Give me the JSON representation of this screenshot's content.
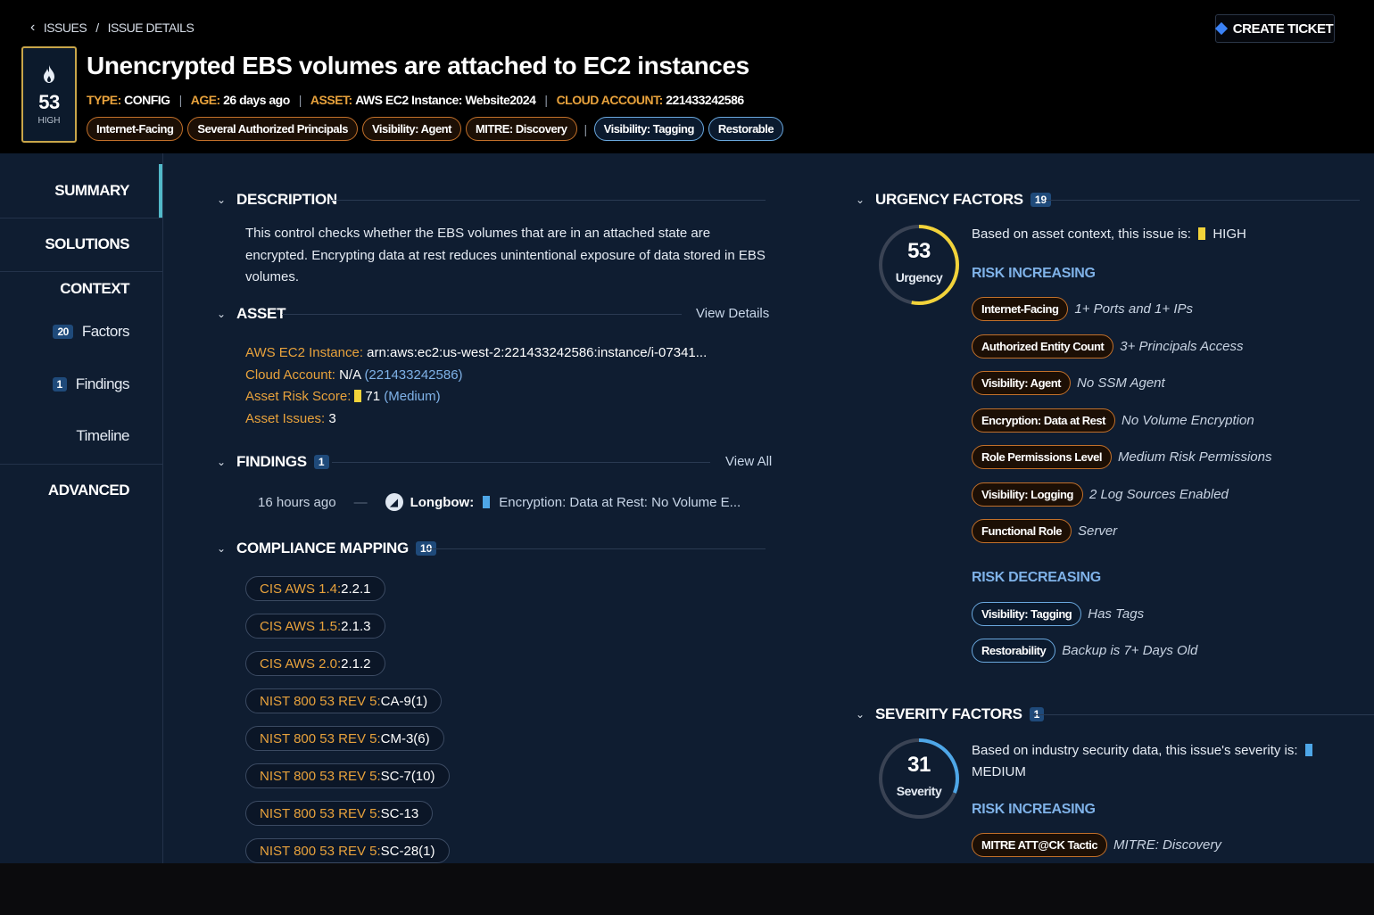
{
  "breadcrumb": {
    "issues": "ISSUES",
    "sep": "/",
    "current": "ISSUE DETAILS"
  },
  "create_ticket": "CREATE TICKET",
  "score": {
    "value": "53",
    "level": "HIGH"
  },
  "title": "Unencrypted EBS volumes are attached to EC2 instances",
  "meta": [
    {
      "key": "TYPE:",
      "value": "CONFIG"
    },
    {
      "key": "AGE:",
      "value": "26 days ago"
    },
    {
      "key": "ASSET:",
      "value": "AWS EC2 Instance: Website2024"
    },
    {
      "key": "CLOUD ACCOUNT:",
      "value": "221433242586"
    }
  ],
  "tags_orange": [
    "Internet-Facing",
    "Several Authorized Principals",
    "Visibility: Agent",
    "MITRE: Discovery"
  ],
  "tags_blue": [
    "Visibility: Tagging",
    "Restorable"
  ],
  "nav": {
    "summary": "SUMMARY",
    "solutions": "SOLUTIONS",
    "context": "CONTEXT",
    "factors_count": "20",
    "factors": "Factors",
    "findings_count": "1",
    "findings": "Findings",
    "timeline": "Timeline",
    "advanced": "ADVANCED"
  },
  "description": {
    "title": "DESCRIPTION",
    "text": "This control checks whether the EBS volumes that are in an attached state are encrypted. Encrypting data at rest reduces unintentional exposure of data stored in EBS volumes."
  },
  "asset": {
    "title": "ASSET",
    "link": "View Details",
    "instance_key": "AWS EC2 Instance:",
    "instance_val": "arn:aws:ec2:us-west-2:221433242586:instance/i-07341...",
    "account_key": "Cloud Account:",
    "account_val": "N/A",
    "account_id": "(221433242586)",
    "risk_key": "Asset Risk Score:",
    "risk_val": "71",
    "risk_level": "(Medium)",
    "issues_key": "Asset Issues:",
    "issues_val": "3",
    "risk_color": "#f2d33a"
  },
  "findings": {
    "title": "FINDINGS",
    "count": "1",
    "link": "View All",
    "time": "16 hours ago",
    "source": "Longbow:",
    "text": "Encryption: Data at Rest: No Volume E...",
    "marker_color": "#4ea7e8"
  },
  "compliance": {
    "title": "COMPLIANCE MAPPING",
    "count": "10",
    "items": [
      {
        "std": "CIS AWS 1.4:",
        "ctrl": "2.2.1"
      },
      {
        "std": "CIS AWS 1.5:",
        "ctrl": "2.1.3"
      },
      {
        "std": "CIS AWS 2.0:",
        "ctrl": "2.1.2"
      },
      {
        "std": "NIST 800 53 REV 5:",
        "ctrl": "CA-9(1)"
      },
      {
        "std": "NIST 800 53 REV 5:",
        "ctrl": "CM-3(6)"
      },
      {
        "std": "NIST 800 53 REV 5:",
        "ctrl": "SC-7(10)"
      },
      {
        "std": "NIST 800 53 REV 5:",
        "ctrl": "SC-13"
      },
      {
        "std": "NIST 800 53 REV 5:",
        "ctrl": "SC-28(1)"
      }
    ]
  },
  "urgency": {
    "title": "URGENCY FACTORS",
    "count": "19",
    "gauge_value": "53",
    "gauge_label": "Urgency",
    "gauge_fraction": 0.53,
    "gauge_color": "#f2d33a",
    "context_text": "Based on asset context, this issue is:",
    "context_level": "HIGH",
    "increasing_title": "RISK INCREASING",
    "increasing": [
      {
        "tag": "Internet-Facing",
        "value": "1+ Ports and 1+ IPs"
      },
      {
        "tag": "Authorized Entity Count",
        "value": "3+ Principals Access"
      },
      {
        "tag": "Visibility: Agent",
        "value": "No SSM Agent"
      },
      {
        "tag": "Encryption: Data at Rest",
        "value": "No Volume Encryption"
      },
      {
        "tag": "Role Permissions Level",
        "value": "Medium Risk Permissions"
      },
      {
        "tag": "Visibility: Logging",
        "value": "2 Log Sources Enabled"
      },
      {
        "tag": "Functional Role",
        "value": "Server"
      }
    ],
    "decreasing_title": "RISK DECREASING",
    "decreasing": [
      {
        "tag": "Visibility: Tagging",
        "value": "Has Tags"
      },
      {
        "tag": "Restorability",
        "value": "Backup is 7+ Days Old"
      }
    ]
  },
  "severity": {
    "title": "SEVERITY FACTORS",
    "count": "1",
    "gauge_value": "31",
    "gauge_label": "Severity",
    "gauge_fraction": 0.31,
    "gauge_color": "#4ea7e8",
    "context_text": "Based on industry security data, this issue's severity is:",
    "context_level": "MEDIUM",
    "increasing_title": "RISK INCREASING",
    "increasing": [
      {
        "tag": "MITRE ATT@CK Tactic",
        "value": "MITRE: Discovery"
      }
    ]
  }
}
